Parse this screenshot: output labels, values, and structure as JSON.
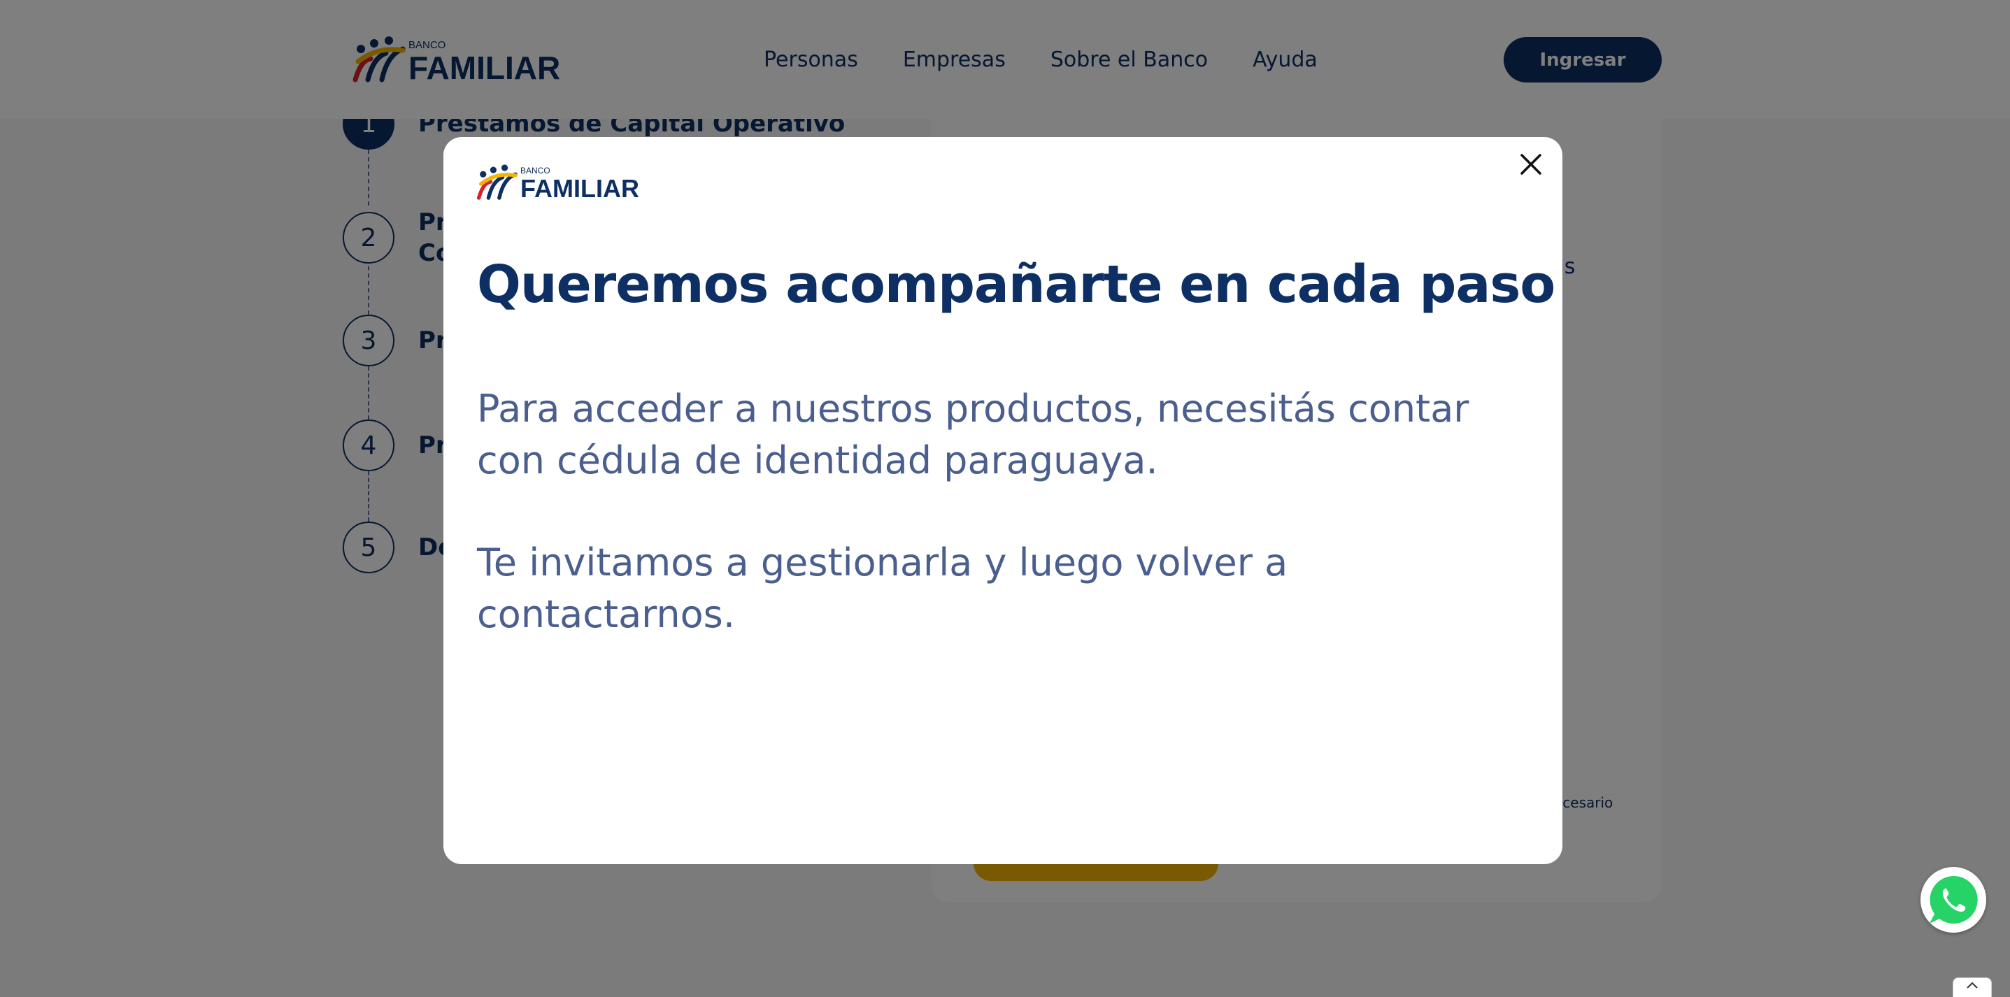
{
  "brand": {
    "small": "BANCO",
    "name": "FAMILIAR"
  },
  "nav": {
    "items": [
      {
        "label": "Personas"
      },
      {
        "label": "Empresas"
      },
      {
        "label": "Sobre el Banco"
      },
      {
        "label": "Ayuda"
      }
    ],
    "login_label": "Ingresar"
  },
  "steps": [
    {
      "number": "1",
      "label": "Préstamos de Capital Operativo"
    },
    {
      "number": "2",
      "label": "Pr\nCo"
    },
    {
      "number": "3",
      "label": "Pr"
    },
    {
      "number": "4",
      "label": "Pr"
    },
    {
      "number": "5",
      "label": "De"
    }
  ],
  "panel": {
    "fragment_1": "ias",
    "fragment_2": "ecesario"
  },
  "modal": {
    "title": "Queremos acompañarte en cada paso",
    "paragraph_1": "Para acceder a nuestros productos, necesitás contar con cédula de identidad paraguaya.",
    "paragraph_2": "Te invitamos a gestionarla y luego volver a contactarnos."
  },
  "icons": {
    "close": "close-icon",
    "whatsapp": "whatsapp-icon",
    "scroll_top": "chevron-up-icon"
  },
  "colors": {
    "brand_blue": "#0d2f63",
    "text_blue": "#4a5f8e",
    "yellow": "#f5b400",
    "red": "#d6232a",
    "whatsapp": "#25d366"
  }
}
